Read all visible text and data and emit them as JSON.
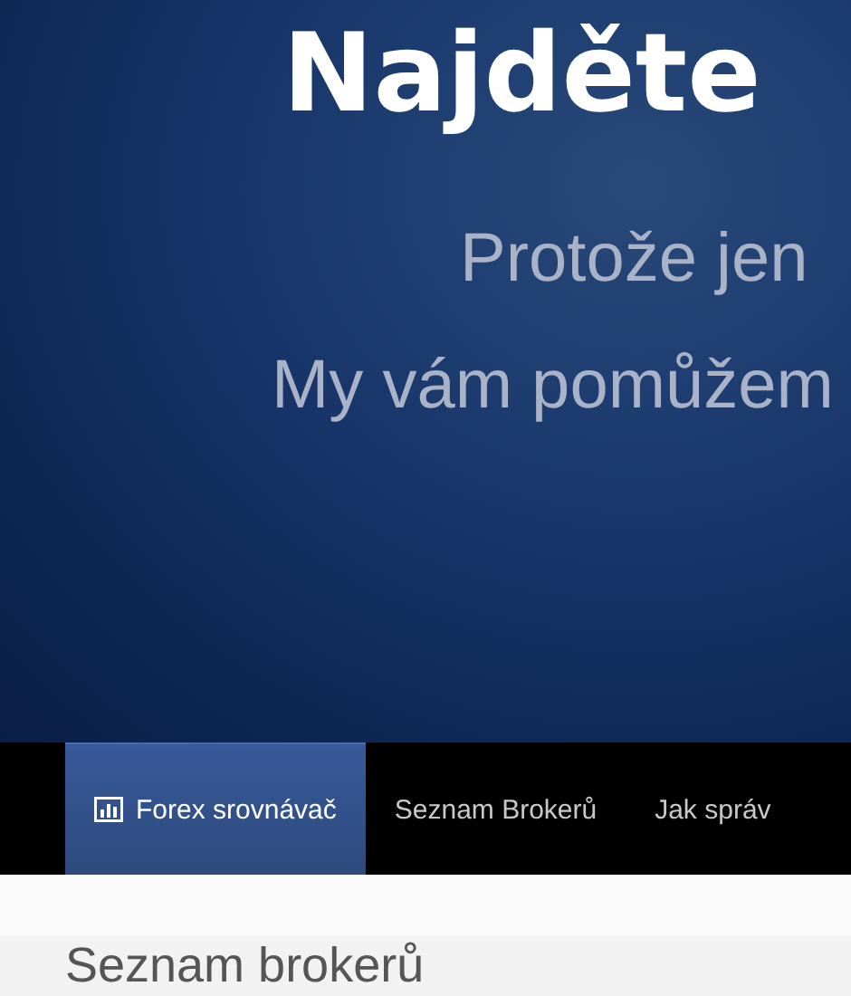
{
  "hero": {
    "title": "Najděte",
    "subtitle_lines": [
      "Protože jen",
      "My vám pomůžem"
    ]
  },
  "nav": [
    {
      "label": "Forex srovnávač",
      "selected": true,
      "kind": "with_icon"
    },
    {
      "label": "Seznam Brokerů",
      "selected": false
    },
    {
      "label": "Jak správ",
      "selected": false
    }
  ],
  "section": {
    "heading": "Seznam brokerů"
  }
}
